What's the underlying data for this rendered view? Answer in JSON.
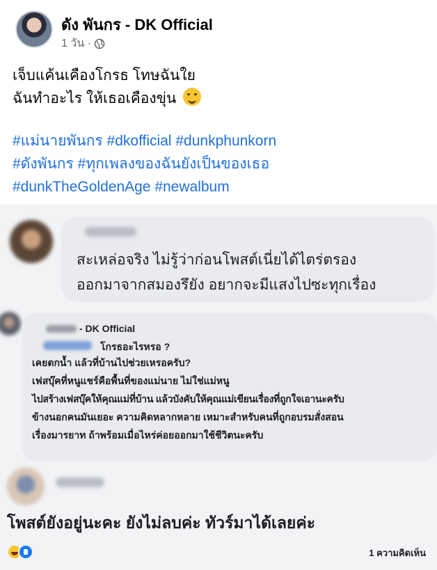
{
  "post": {
    "author": "ดัง พันกร - DK Official",
    "time": "1 วัน ·",
    "audience_icon": "globe-icon",
    "text_lines": [
      "เจ็บแค้นเคืองโกรธ โทษฉันใย",
      "ฉันทำอะไร ให้เธอเคืองขุ่น"
    ],
    "emoji": "smiling-face-emoji",
    "hashtag_lines": [
      "#แม่นายพันกร #dkofficial #dunkphunkorn",
      "#ดังพันกร #ทุกเพลงของฉันยังเป็นของเธอ",
      "#dunkTheGoldenAge #newalbum"
    ]
  },
  "comment1": {
    "text_lines": [
      "สะเหล่อจริง ไม่รู้ว่าก่อนโพสต์เนี่ยได้ไตร่ตรอง",
      "ออกมาจากสมองรึยัง อยากจะมีแสงไปซะทุกเรื่อง"
    ]
  },
  "comment2": {
    "author_suffix": "- DK Official",
    "reply_text": "โกรธอะไรหรอ ?",
    "lines": [
      "เคยตกน้ำ แล้วที่บ้านไปช่วยเหรอครับ?",
      "เฟสบุ๊คที่หนูแชร์คือพื้นที่ของแม่นาย ไม่ใช่แม่หนู",
      "ไปสร้างเฟสบุ๊คให้คุณแม่ที่บ้าน แล้วบังคับให้คุณแม่เขียนเรื่องที่ถูกใจเอานะครับ",
      "ข้างนอกคนมันเยอะ ความคิดหลากหลาย  เหมาะสำหรับคนที่ถูกอบรมสั่งสอน",
      "เรื่องมารยาท ถ้าพร้อมเมื่อไหร่ค่อยออกมาใช้ชีวิตนะครับ"
    ]
  },
  "comment3": {
    "text": "โพสต์ยังอยู่นะคะ ยังไม่ลบค่ะ ทัวร์มาได้เลยค่ะ",
    "reactions": [
      "haha-reaction-icon",
      "like-reaction-icon"
    ],
    "comment_count": "1 ความคิดเห็น"
  },
  "colors": {
    "hashtag": "#216fdb",
    "secondary_text": "#65676b",
    "bubble": "#e9ebee",
    "comments_bg": "#f2f3f5"
  }
}
